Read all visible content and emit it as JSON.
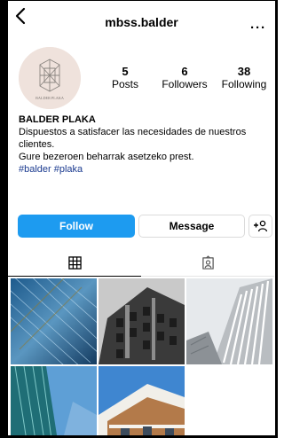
{
  "header": {
    "username": "mbss.balder",
    "back_icon": "chevron-left-icon",
    "more_icon": "ellipsis-icon"
  },
  "profile": {
    "avatar_text": "BALDER PLAKA",
    "stats": [
      {
        "value": "5",
        "label": "Posts"
      },
      {
        "value": "6",
        "label": "Followers"
      },
      {
        "value": "38",
        "label": "Following"
      }
    ],
    "name": "BALDER PLAKA",
    "bio_lines": [
      "Dispuestos a satisfacer las necesidades de nuestros",
      "clientes.",
      "Gure bezeroen beharrak asetzeko prest."
    ],
    "hashtags": "#balder #plaka"
  },
  "actions": {
    "follow_label": "Follow",
    "message_label": "Message",
    "add_user_icon": "add-person-icon",
    "follow_color": "#1d9bf0"
  },
  "tabs": [
    {
      "icon": "grid-icon",
      "active": true
    },
    {
      "icon": "tagged-person-icon",
      "active": false
    }
  ],
  "posts": [
    {
      "subject": "glass-tower"
    },
    {
      "subject": "dark-building"
    },
    {
      "subject": "white-facade"
    },
    {
      "subject": "teal-glass-building"
    },
    {
      "subject": "brick-balconies"
    }
  ]
}
